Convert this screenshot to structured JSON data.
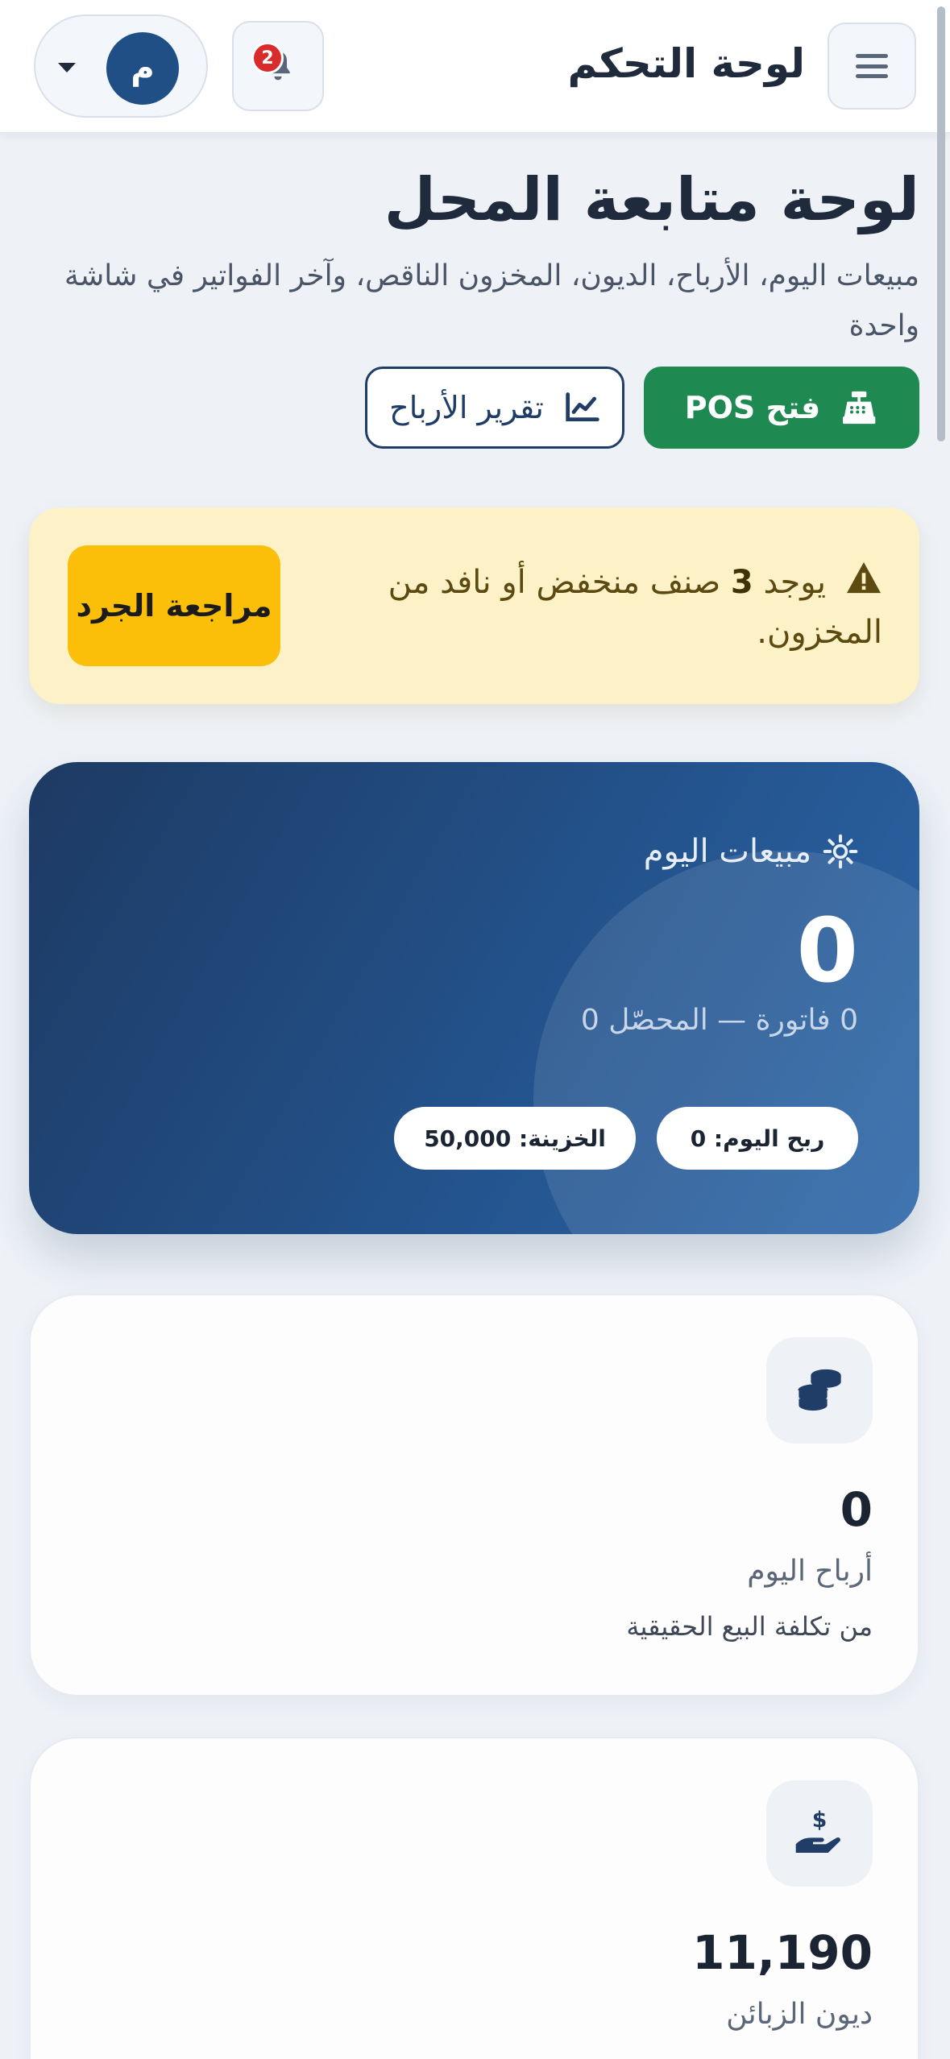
{
  "topbar": {
    "title": "لوحة التحكم",
    "notification_count": "2",
    "user_initial": "م"
  },
  "header": {
    "title": "لوحة متابعة المحل",
    "subtitle": "مبيعات اليوم، الأرباح، الديون، المخزون الناقص، وآخر الفواتير في شاشة واحدة",
    "pos_button": "فتح POS",
    "report_button": "تقرير الأرباح"
  },
  "alert": {
    "prefix": "يوجد",
    "count": "3",
    "suffix": "صنف منخفض أو نافد من المخزون.",
    "button": "مراجعة الجرد"
  },
  "hero": {
    "label": "مبيعات اليوم",
    "value": "0",
    "sub": "0 فاتورة — المحصّل 0",
    "profit_pill": "ربح اليوم: 0",
    "treasury_pill": "الخزينة: 50,000"
  },
  "cards": {
    "profits": {
      "value": "0",
      "label": "أرباح اليوم",
      "note": "من تكلفة البيع الحقيقية",
      "icon": "coins-icon"
    },
    "debts": {
      "value": "11,190",
      "label": "ديون الزبائن",
      "icon": "hand-dollar-icon"
    }
  },
  "colors": {
    "primary": "#1f4f85",
    "success": "#1e8a52",
    "warning_bg": "#fdf1c7",
    "warning_btn": "#fbbf0a",
    "badge": "#d92b2b"
  }
}
